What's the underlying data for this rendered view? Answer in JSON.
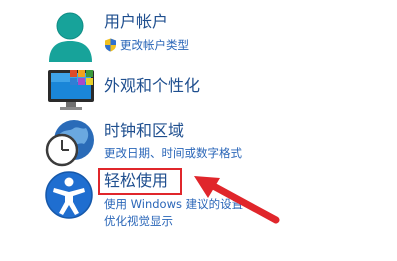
{
  "categories": [
    {
      "title": "用户帐户",
      "links": [
        "更改帐户类型"
      ],
      "icon": "user-icon"
    },
    {
      "title": "外观和个性化",
      "links": [],
      "icon": "monitor-icon"
    },
    {
      "title": "时钟和区域",
      "links": [
        "更改日期、时间或数字格式"
      ],
      "icon": "globe-clock-icon"
    },
    {
      "title": "轻松使用",
      "links": [
        "使用 Windows 建议的设置",
        "优化视觉显示"
      ],
      "icon": "accessibility-icon"
    }
  ],
  "annotation": {
    "highlight_color": "#e0262b",
    "arrow_color": "#e0262b"
  }
}
